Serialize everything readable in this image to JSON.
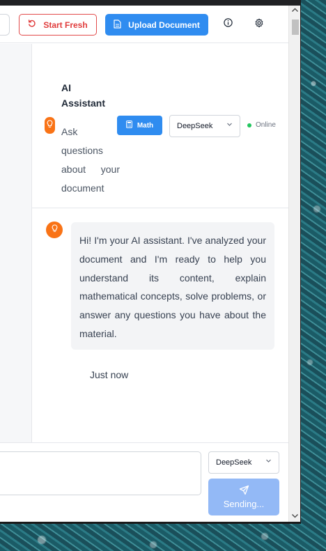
{
  "header": {
    "start_fresh_label": "Start Fresh",
    "upload_label": "Upload Document",
    "info_icon": "info-icon",
    "settings_icon": "gear-icon"
  },
  "chat_header": {
    "title": "AI Assistant",
    "subtitle": "Ask questions about your document",
    "math_label": "Math",
    "model_selected": "DeepSeek",
    "status": "Online"
  },
  "messages": [
    {
      "role": "assistant",
      "text": "Hi! I'm your AI assistant. I've analyzed your document and I'm ready to help you understand its content, explain mathematical concepts, solve problems, or answer any questions you have about the material.",
      "time": "Just now"
    }
  ],
  "composer": {
    "input_value": "",
    "model_selected": "DeepSeek",
    "send_label": "Sending..."
  },
  "colors": {
    "primary": "#2f8cf0",
    "danger": "#e03b3b",
    "accent": "#f97316",
    "online": "#22c55e"
  }
}
